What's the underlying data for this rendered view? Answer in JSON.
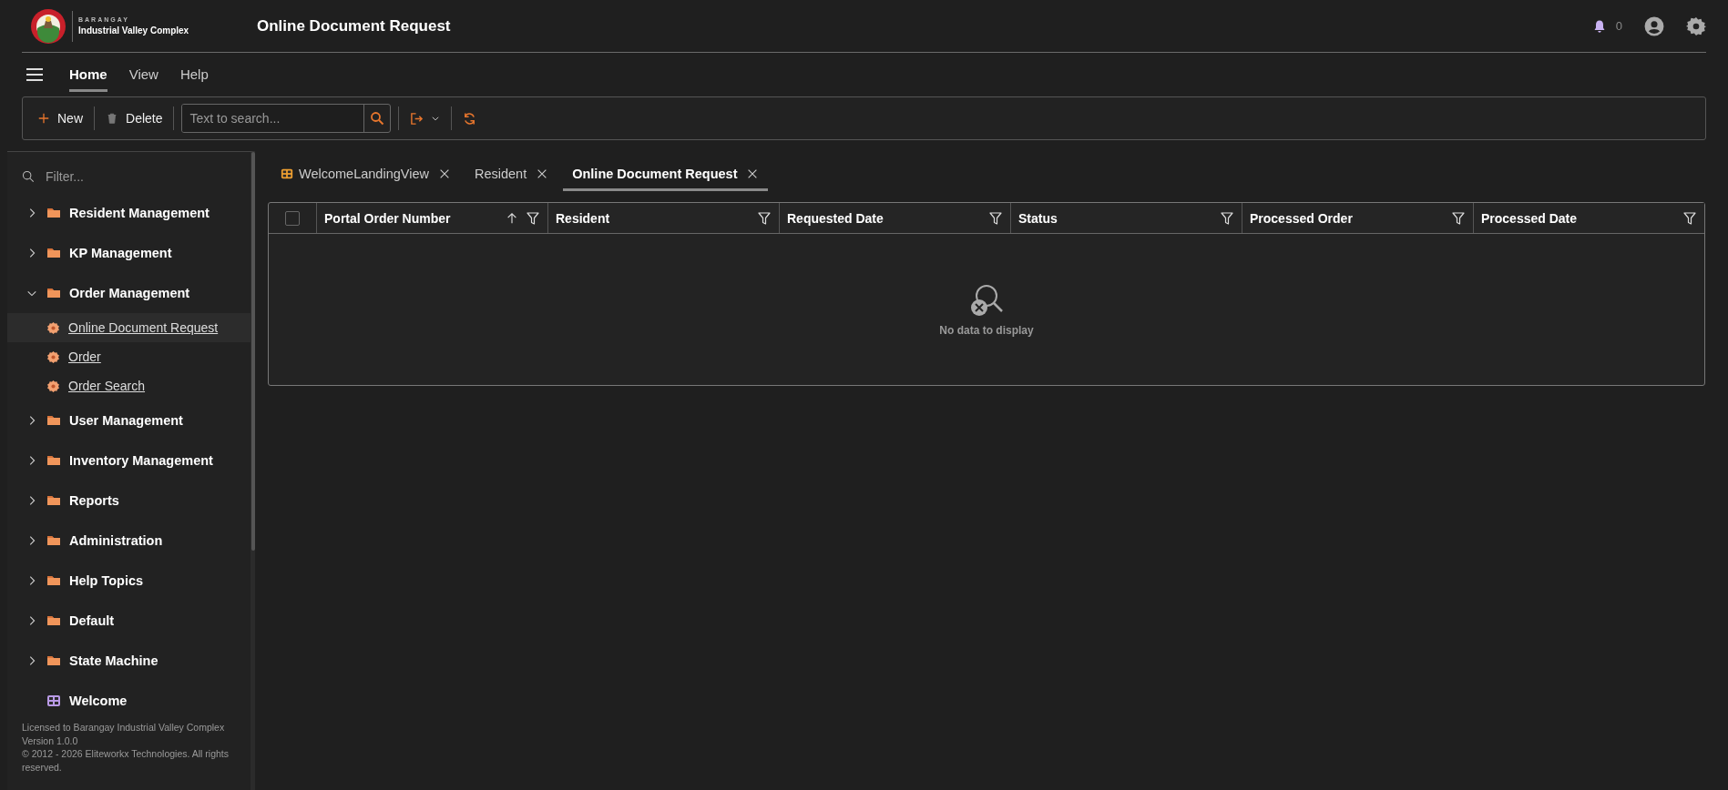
{
  "header": {
    "org_caption": "BARANGAY",
    "org_name": "Industrial Valley Complex",
    "title": "Online Document Request",
    "notification_count": "0"
  },
  "menu": {
    "tabs": [
      {
        "label": "Home",
        "selected": true
      },
      {
        "label": "View",
        "selected": false
      },
      {
        "label": "Help",
        "selected": false
      }
    ]
  },
  "toolbar": {
    "buttons": [
      {
        "label": "New",
        "kind": "add"
      },
      {
        "label": "Delete",
        "kind": "delete"
      }
    ],
    "search": {
      "placeholder": "Text to search..."
    }
  },
  "sidebar": {
    "filter": {
      "placeholder": "Filter..."
    },
    "items": [
      {
        "label": "Resident Management",
        "kind": "folder",
        "expanded": false
      },
      {
        "label": "KP Management",
        "kind": "folder",
        "expanded": false
      },
      {
        "label": "Order Management",
        "kind": "folder",
        "expanded": true,
        "children": [
          {
            "label": "Online Document Request",
            "selected": true
          },
          {
            "label": "Order",
            "selected": false
          },
          {
            "label": "Order Search",
            "selected": false
          }
        ]
      },
      {
        "label": "User Management",
        "kind": "folder",
        "expanded": false
      },
      {
        "label": "Inventory Management",
        "kind": "folder",
        "expanded": false
      },
      {
        "label": "Reports",
        "kind": "folder",
        "expanded": false
      },
      {
        "label": "Administration",
        "kind": "folder",
        "expanded": false
      },
      {
        "label": "Help Topics",
        "kind": "folder",
        "expanded": false
      },
      {
        "label": "Default",
        "kind": "folder",
        "expanded": false
      },
      {
        "label": "State Machine",
        "kind": "folder",
        "expanded": false
      },
      {
        "label": "Welcome",
        "kind": "dashboard"
      }
    ],
    "footer": [
      "Licensed to Barangay Industrial Valley Complex",
      "Version 1.0.0",
      "© 2012 - 2026 Eliteworkx Technologies. All rights reserved."
    ]
  },
  "tabs": [
    {
      "label": "WelcomeLandingView",
      "kind": "dashboard",
      "selected": false
    },
    {
      "label": "Resident",
      "kind": "view",
      "selected": false
    },
    {
      "label": "Online Document Request",
      "kind": "view",
      "selected": true
    }
  ],
  "grid": {
    "all_selected": false,
    "columns": [
      {
        "label": "Portal Order Number",
        "sorted": true
      },
      {
        "label": "Resident",
        "sorted": false
      },
      {
        "label": "Requested Date",
        "sorted": false
      },
      {
        "label": "Status",
        "sorted": false
      },
      {
        "label": "Processed Order",
        "sorted": false
      },
      {
        "label": "Processed Date",
        "sorted": false
      }
    ],
    "empty_text": "No data to display"
  }
}
